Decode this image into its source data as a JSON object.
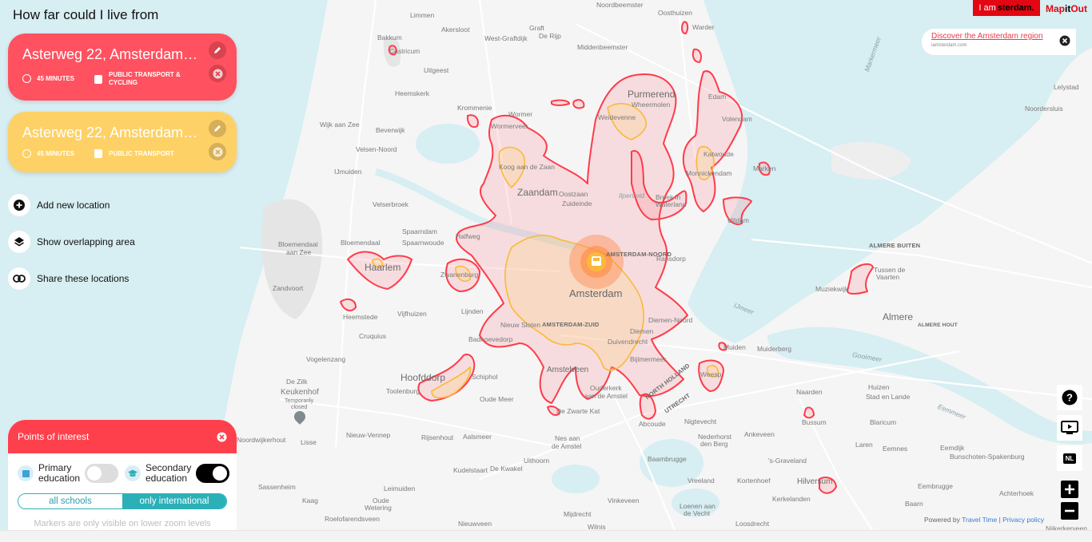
{
  "header": {
    "title": "How far could I live from"
  },
  "locations": [
    {
      "address": "Asterweg 22, Amsterdam…",
      "duration": "45 MINUTES",
      "mode_line1": "PUBLIC TRANSPORT &",
      "mode_line2": "CYCLING",
      "color": "#ff515f",
      "mode_icon": "bus-bike-icon"
    },
    {
      "address": "Asterweg 22, Amsterdam…",
      "duration": "45 MINUTES",
      "mode_line1": "PUBLIC TRANSPORT",
      "mode_line2": "",
      "color": "#fed166",
      "mode_icon": "bus-icon"
    }
  ],
  "actions": [
    {
      "label": "Add new location",
      "icon": "plus-circle-icon"
    },
    {
      "label": "Show overlapping area",
      "icon": "layers-icon"
    },
    {
      "label": "Share these locations",
      "icon": "link-icon"
    }
  ],
  "poi": {
    "title": "Points of interest",
    "primary": {
      "line1": "Primary",
      "line2": "education",
      "enabled": false
    },
    "secondary": {
      "line1": "Secondary",
      "line2": "education",
      "enabled": true
    },
    "filter_options": [
      "all schools",
      "only international"
    ],
    "filter_selected": "only international",
    "hint": "Markers are only visible on lower zoom levels"
  },
  "branding": {
    "iam_prefix": "I am",
    "iam_suffix": "sterdam.",
    "mapitout_a": "Map",
    "mapitout_b": "it",
    "mapitout_c": "Out"
  },
  "banner": {
    "link": "Discover the Amsterdam region",
    "sub": "iamsterdam.com"
  },
  "controls": [
    {
      "name": "help-button",
      "icon": "question-icon"
    },
    {
      "name": "video-button",
      "icon": "play-screen-icon"
    },
    {
      "name": "language-button",
      "label": "NL"
    },
    {
      "name": "zoom-in-button",
      "icon": "plus-icon"
    },
    {
      "name": "zoom-out-button",
      "icon": "minus-icon"
    }
  ],
  "attribution": {
    "prefix": "Powered by ",
    "travel_time": "Travel Time",
    "sep": " | ",
    "privacy": "Privacy policy"
  },
  "colors": {
    "red": "#ff515f",
    "yellow": "#fed166",
    "teal": "#2bb0b8",
    "water": "#d7eef2",
    "land": "#f5f5f5"
  },
  "map_labels": {
    "noordbeemster": "Noordbeemster",
    "oosthuizen": "Oosthuizen",
    "warder": "Warder",
    "limmen": "Limmen",
    "akersloot": "Akersloot",
    "graft": "Graft",
    "derijp": "De Rijp",
    "westgraftdijk": "West-Graftdijk",
    "middenbeemster": "Middenbeemster",
    "bakkum": "Bakkum",
    "castricum": "Castricum",
    "uitgeest": "Uitgeest",
    "heemskerk": "Heemskerk",
    "krommenie": "Krommenie",
    "wormer": "Wormer",
    "wormerveer": "Wormerveer",
    "wijkaanzee": "Wijk aan Zee",
    "beverwijk": "Beverwijk",
    "velsennoord": "Velsen-Noord",
    "umuiden": "IJmuiden",
    "purmerend": "Purmerend",
    "wheermolen": "Wheermolen",
    "weidevenne": "Weidevenne",
    "edam": "Edam",
    "volendam": "Volendam",
    "katwoude": "Katwoude",
    "monnickendam": "Monnickendam",
    "marken": "Marken",
    "markermeer": "Markermeer",
    "lelystad": "Lelystad",
    "noordersluis": "Noordersluis",
    "koogaandezaan": "Koog aan de Zaan",
    "zaandam": "Zaandam",
    "oostzaan": "Oostzaan",
    "zuideinde": "Zuideinde",
    "ilperveld": "Ilperveld",
    "broekinwaterland": "Broek in Waterland",
    "uitdam": "Uitdam",
    "velserbroek": "Velserbroek",
    "spaarndam": "Spaarndam",
    "spaarnwoude": "Spaarnwoude",
    "bloemendaal": "Bloemendaal",
    "bloemendaalaanzee1": "Bloemendaal",
    "bloemendaalaanzee2": "aan Zee",
    "haarlem": "Haarlem",
    "zandvoort": "Zandvoort",
    "halfweg": "Halfweg",
    "zwanenburg": "Zwanenburg",
    "amsterdam": "Amsterdam",
    "amsterdamnoord": "AMSTERDAM-NOORD",
    "ransdorp": "Ransdorp",
    "heemstede": "Heemstede",
    "vijfhuizen": "Vijfhuizen",
    "lijnden": "Lijnden",
    "nieuwsloten": "Nieuw Sloten",
    "amsterdamzuid": "AMSTERDAM-ZUID",
    "diemen": "Diemen",
    "diemennoord": "Diemen-Noord",
    "duivendrecht": "Duivendrecht",
    "bijlmermeer": "Bijlmermeer",
    "cruquius": "Cruquius",
    "badhoevedorp": "Badhoevedorp",
    "vogelenzang": "Vogelenzang",
    "dezilk": "De Zilk",
    "keukenhof": "Keukenhof",
    "keukenhof_t1": "Temporarily",
    "keukenhof_t2": "closed",
    "hoofddorp": "Hoofddorp",
    "toolenburg": "Toolenburg",
    "schiphol": "Schiphol",
    "oudemeer": "Oude Meer",
    "amstelveen": "Amstelveen",
    "ouderkerk1": "Ouderkerk",
    "ouderkerk2": "aan de Amstel",
    "dezwartekat": "De Zwarte Kat",
    "northholland": "NORTH HOLLAND",
    "utrecht": "UTRECHT",
    "abcoude": "Abcoude",
    "nigtevecht": "Nigtevecht",
    "noordwijkerhout": "Noordwijkerhout",
    "lisse": "Lisse",
    "nieuwvennep": "Nieuw-Vennep",
    "rijsenhout": "Rijsenhout",
    "aalsmeer": "Aalsmeer",
    "nesaandeamstel1": "Nes aan",
    "nesaandeamstel2": "de Amstel",
    "uithoorn": "Uithoorn",
    "kudelstaart": "Kudelstaart",
    "dekwakel": "De Kwakel",
    "baambrugge": "Baambrugge",
    "sassenheim": "Sassenheim",
    "kaag": "Kaag",
    "leimuiden": "Leimuiden",
    "oudewetering1": "Oude",
    "oudewetering2": "Wetering",
    "roelofarendsveen": "Roelofarendsveen",
    "vinkeveen": "Vinkeveen",
    "mijdrecht": "Mijdrecht",
    "wilnis": "Wilnis",
    "nieuwveen": "Nieuwveen",
    "muiden": "Muiden",
    "muiderberg": "Muiderberg",
    "weesp": "Weesp",
    "ijmeer": "IJmeer",
    "gooimeer": "Gooimeer",
    "nederhorst1": "Nederhorst",
    "nederhorst2": "den Berg",
    "ankeveen": "Ankeveen",
    "naarden": "Naarden",
    "bussum": "Bussum",
    "huizen": "Huizen",
    "stadenlande": "Stad en Lande",
    "blaricum": "Blaricum",
    "laren": "Laren",
    "eemnes": "Eemnes",
    "sgraveland": "'s-Graveland",
    "hilversum": "Hilversum",
    "kortenhoef": "Kortenhoef",
    "vreeland": "Vreeland",
    "kerkelanden": "Kerkelanden",
    "loenen1": "Loenen aan",
    "loenen2": "de Vecht",
    "loosdrecht": "Loosdrecht",
    "almerebuiten": "ALMERE BUITEN",
    "tussendevaarten1": "Tussen de",
    "tussendevaarten2": "Vaarten",
    "muziekwijk": "Muziekwijk",
    "almere": "Almere",
    "almerehout": "ALMERE HOUT",
    "eemmeer": "Eemmeer",
    "eemdijk": "Eemdijk",
    "bunschoten": "Bunschoten-Spakenburg",
    "eembrugge": "Eembrugge",
    "baarn": "Baarn",
    "achterhoek": "Achterhoek",
    "nijkerkerveen": "Nijkerkerveen"
  }
}
